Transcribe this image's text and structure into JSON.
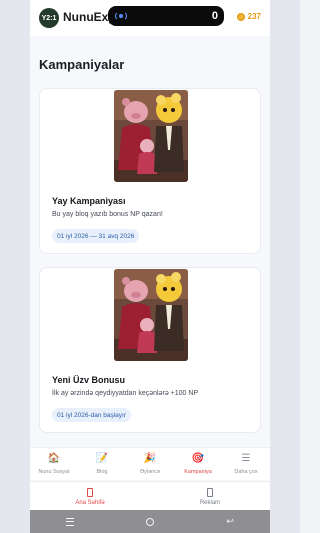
{
  "header": {
    "logo_text": "Y2:1",
    "app_title": "NunuExp",
    "np_balance": "237"
  },
  "overlay": {
    "count": "0"
  },
  "page": {
    "title": "Kampaniyalar"
  },
  "campaigns": [
    {
      "title": "Yay Kampaniyası",
      "description": "Bu yay bloq yazıb bonus NP qazan!",
      "date": "01 iyl 2026 — 31 avq 2026"
    },
    {
      "title": "Yeni Üzv Bonusu",
      "description": "İlk ay ərzində qeydiyyatdan keçənlərə +100 NP",
      "date": "01 iyl 2026-dan başlayır"
    }
  ],
  "bottom_nav": [
    {
      "label": "Nunu Sosyal",
      "icon": "home-icon"
    },
    {
      "label": "Blog",
      "icon": "notepad-icon"
    },
    {
      "label": "Əyləncə",
      "icon": "party-popper-icon"
    },
    {
      "label": "Kampaniya",
      "icon": "target-icon",
      "active": true
    },
    {
      "label": "Daha çox",
      "icon": "menu-icon"
    }
  ],
  "tabs": [
    {
      "label": "Ana Səhifə",
      "active": true
    },
    {
      "label": "Reklam"
    }
  ],
  "colors": {
    "accent": "#e04a4a",
    "chip_text": "#2c5fa8",
    "coin": "#f2b233"
  }
}
